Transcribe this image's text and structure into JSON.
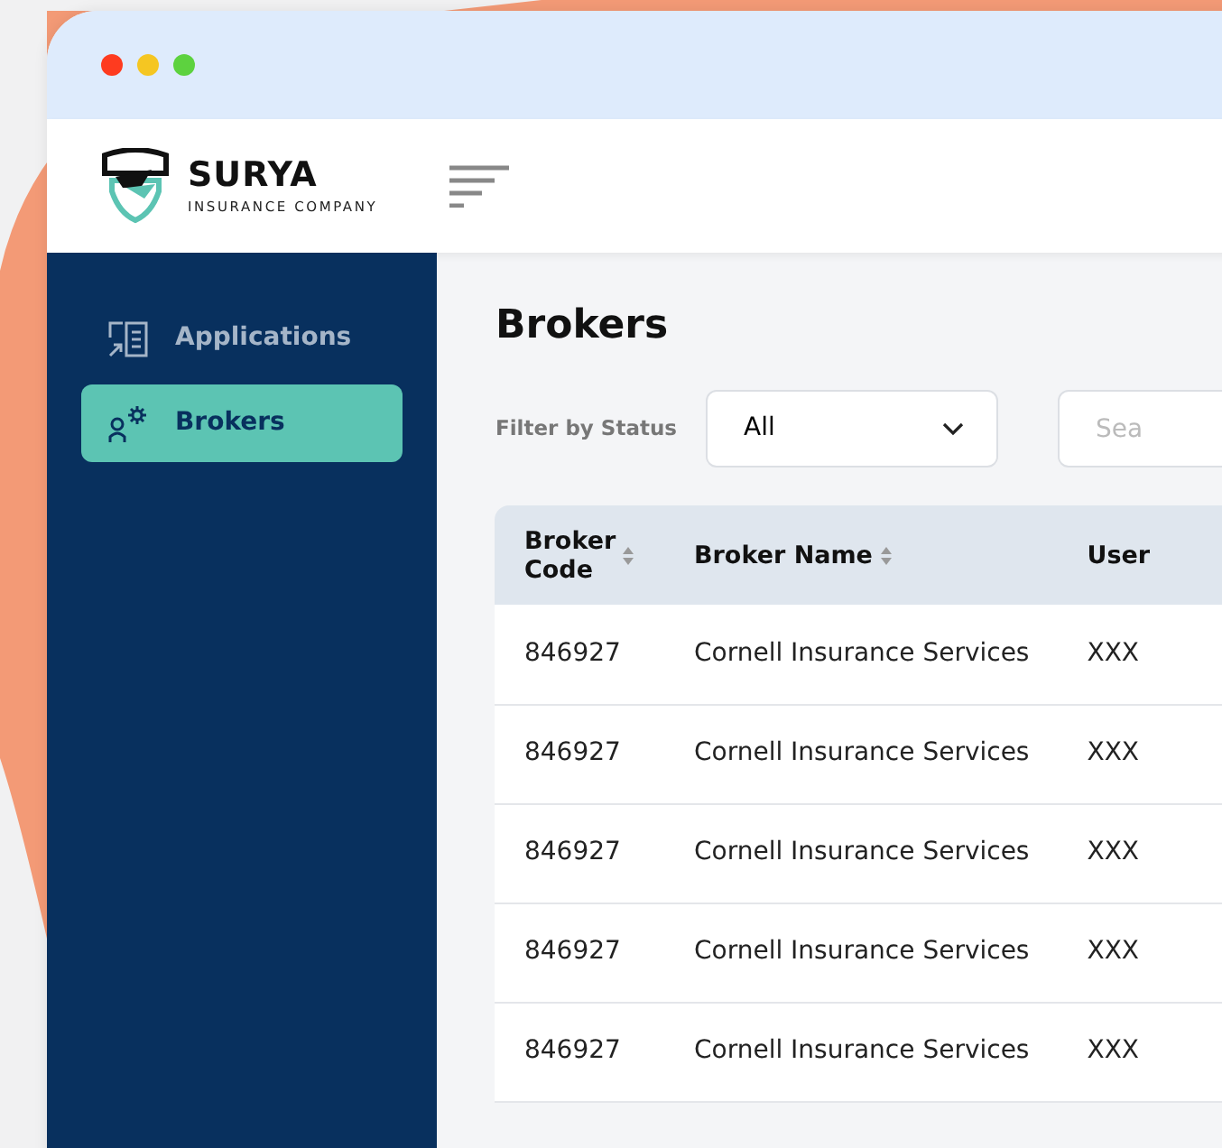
{
  "window": {
    "controls": [
      {
        "color": "#fe3b1f"
      },
      {
        "color": "#f5c622"
      },
      {
        "color": "#5dd23f"
      }
    ]
  },
  "header": {
    "logo": {
      "name": "SURYA",
      "tagline": "INSURANCE COMPANY"
    }
  },
  "sidebar": {
    "items": [
      {
        "label": "Applications",
        "selected": false
      },
      {
        "label": "Brokers",
        "selected": true
      }
    ]
  },
  "page": {
    "title": "Brokers",
    "filter": {
      "label": "Filter by Status",
      "value": "All"
    },
    "search": {
      "placeholder": "Sea"
    }
  },
  "table": {
    "columns": [
      {
        "label": "Broker Code",
        "sortable": true
      },
      {
        "label": "Broker Name",
        "sortable": true
      },
      {
        "label": "User",
        "sortable": false
      }
    ],
    "rows": [
      [
        "846927",
        "Cornell Insurance Services",
        "XXX"
      ],
      [
        "846927",
        "Cornell Insurance Services",
        "XXX"
      ],
      [
        "846927",
        "Cornell Insurance Services",
        "XXX"
      ],
      [
        "846927",
        "Cornell Insurance Services",
        "XXX"
      ],
      [
        "846927",
        "Cornell Insurance Services",
        "XXX"
      ]
    ]
  }
}
